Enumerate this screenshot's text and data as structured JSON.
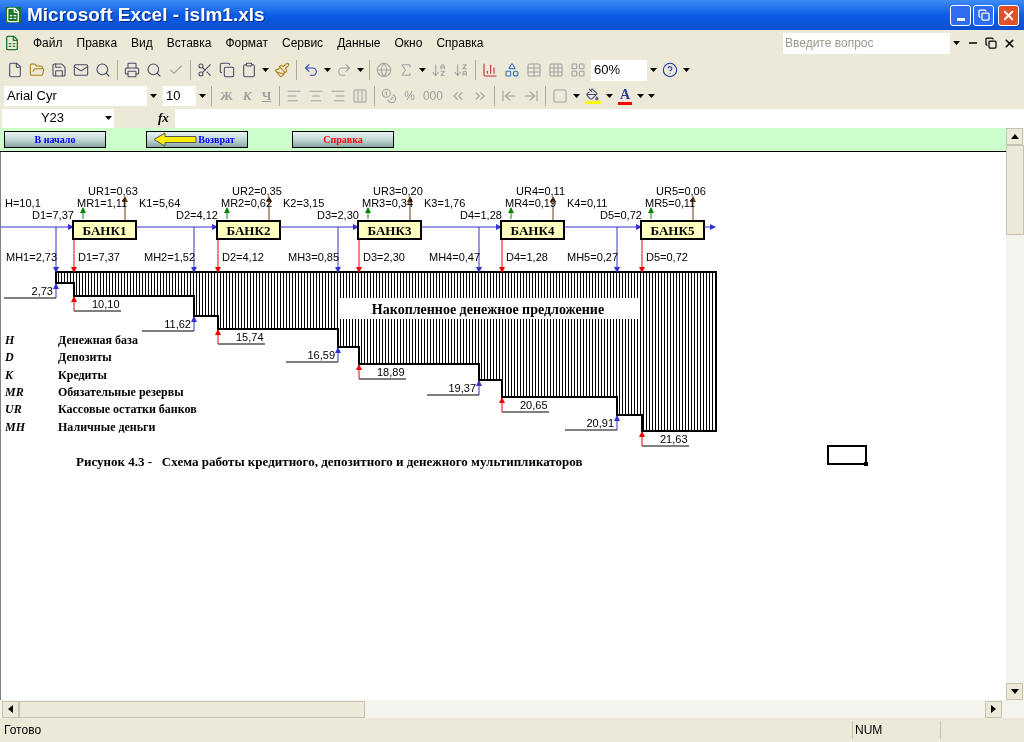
{
  "window": {
    "title": "Microsoft Excel - islm1.xls"
  },
  "menu": [
    "Файл",
    "Правка",
    "Вид",
    "Вставка",
    "Формат",
    "Сервис",
    "Данные",
    "Окно",
    "Справка"
  ],
  "help_box": {
    "placeholder": "Введите вопрос"
  },
  "standard_toolbar": {
    "zoom": "60%"
  },
  "formatting_toolbar": {
    "font": "Arial Cyr",
    "size": "10",
    "style_buttons": [
      "Ж",
      "К",
      "Ч"
    ],
    "number_buttons": [
      "%",
      "000"
    ],
    "font_color": "A"
  },
  "formula_bar": {
    "name_box": "Y23",
    "function_label": "fx"
  },
  "nav_buttons": [
    {
      "label": "В начало",
      "color": "#0000ff",
      "kind": "plain"
    },
    {
      "label": "Возврат",
      "color": "#0000ff",
      "kind": "arrow"
    },
    {
      "label": "Справка",
      "color": "#ff0000",
      "kind": "plain"
    }
  ],
  "diagram": {
    "h_label": "H=10,1",
    "banks": [
      {
        "name": "БАНК1",
        "d_in": "D1=7,37",
        "mr": "MR1=1,11",
        "ur": "UR1=0,63",
        "k": "K1=5,64",
        "mh": "MH1=2,73",
        "d_out": "D1=7,37"
      },
      {
        "name": "БАНК2",
        "d_in": "D2=4,12",
        "mr": "MR2=0,62",
        "ur": "UR2=0,35",
        "k": "K2=3,15",
        "mh": "MH2=1,52",
        "d_out": "D2=4,12"
      },
      {
        "name": "БАНК3",
        "d_in": "D3=2,30",
        "mr": "MR3=0,34",
        "ur": "UR3=0,20",
        "k": "K3=1,76",
        "mh": "MH3=0,85",
        "d_out": "D3=2,30"
      },
      {
        "name": "БАНК4",
        "d_in": "D4=1,28",
        "mr": "MR4=0,19",
        "ur": "UR4=0,11",
        "k": "K4=0,11",
        "mh": "MH4=0,47",
        "d_out": "D4=1,28"
      },
      {
        "name": "БАНК5",
        "d_in": "D5=0,72",
        "mr": "MR5=0,11",
        "ur": "UR5=0,06",
        "mh": "MH5=0,27",
        "d_out": "D5=0,72"
      }
    ],
    "steps": [
      {
        "kind": "mh",
        "value": "2,73"
      },
      {
        "kind": "d",
        "value": "10,10"
      },
      {
        "kind": "mh",
        "value": "11,62"
      },
      {
        "kind": "d",
        "value": "15,74"
      },
      {
        "kind": "mh",
        "value": "16,59"
      },
      {
        "kind": "d",
        "value": "18,89"
      },
      {
        "kind": "mh",
        "value": "19,37"
      },
      {
        "kind": "d",
        "value": "20,65"
      },
      {
        "kind": "mh",
        "value": "20,91"
      },
      {
        "kind": "d",
        "value": "21,63"
      }
    ],
    "area_label": "Накопленное денежное предложение",
    "legend": [
      {
        "symbol": "H",
        "text": "Денежная база"
      },
      {
        "symbol": "D",
        "text": "Депозиты"
      },
      {
        "symbol": "K",
        "text": "Кредиты"
      },
      {
        "symbol": "MR",
        "text": "Обязательные резервы"
      },
      {
        "symbol": "UR",
        "text": "Кассовые остатки банков"
      },
      {
        "symbol": "MH",
        "text": "Наличные деньги"
      }
    ],
    "caption": "Рисунок 4.3 -   Схема работы кредитного, депозитного и денежного мультипликаторов"
  },
  "status_bar": {
    "text": "Готово",
    "indicators": [
      "NUM"
    ]
  }
}
